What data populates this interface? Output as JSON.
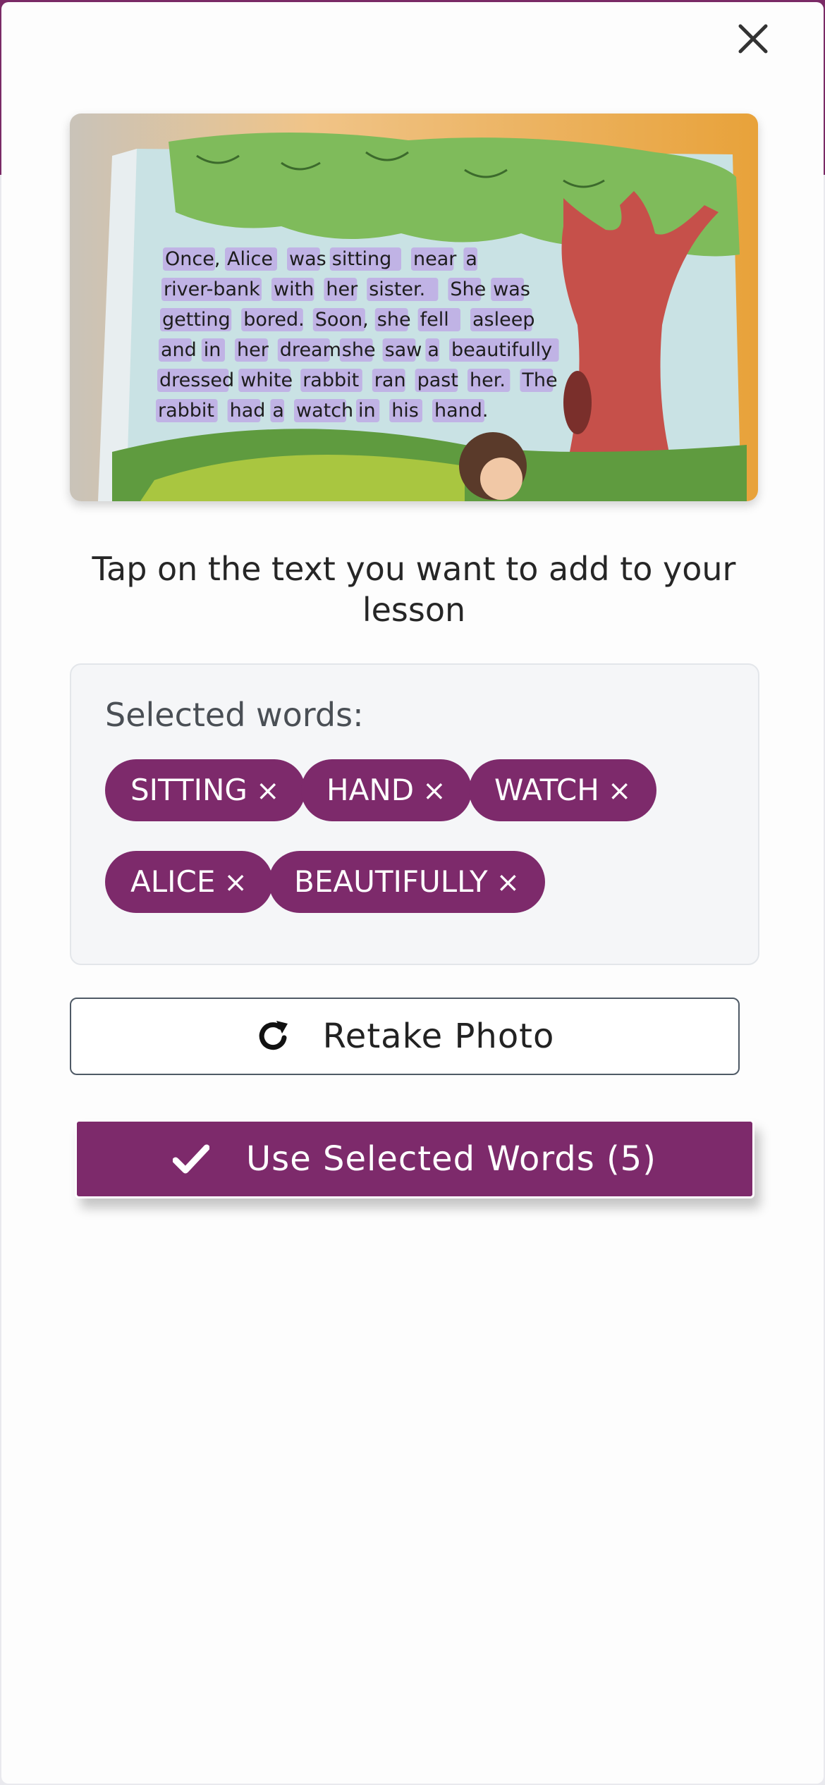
{
  "icons": {
    "close": "close-icon",
    "retake": "redo-icon",
    "use": "check-icon"
  },
  "colors": {
    "accent": "#7d2a6b",
    "backdrop": "#7a2a66",
    "word_highlight": "#b57ae6"
  },
  "photo": {
    "page_lines": [
      [
        "Once,",
        "Alice",
        "was",
        "sitting",
        "near",
        "a"
      ],
      [
        "river-bank",
        "with",
        "her",
        "sister.",
        "She",
        "was"
      ],
      [
        "getting",
        "bored.",
        "Soon,",
        "she",
        "fell",
        "asleep"
      ],
      [
        "and",
        "in",
        "her",
        "dream",
        "she",
        "saw",
        "a",
        "beautifully"
      ],
      [
        "dressed",
        "white",
        "rabbit",
        "ran",
        "past",
        "her.",
        "The"
      ],
      [
        "rabbit",
        "had",
        "a",
        "watch",
        "in",
        "his",
        "hand."
      ]
    ]
  },
  "instruction": "Tap on the text you want to add to your lesson",
  "selected": {
    "label": "Selected words:",
    "remove_symbol": "×",
    "words": [
      "SITTING",
      "HAND",
      "WATCH",
      "ALICE",
      "BEAUTIFULLY"
    ]
  },
  "buttons": {
    "retake": "Retake Photo",
    "use": "Use Selected Words (5)"
  }
}
